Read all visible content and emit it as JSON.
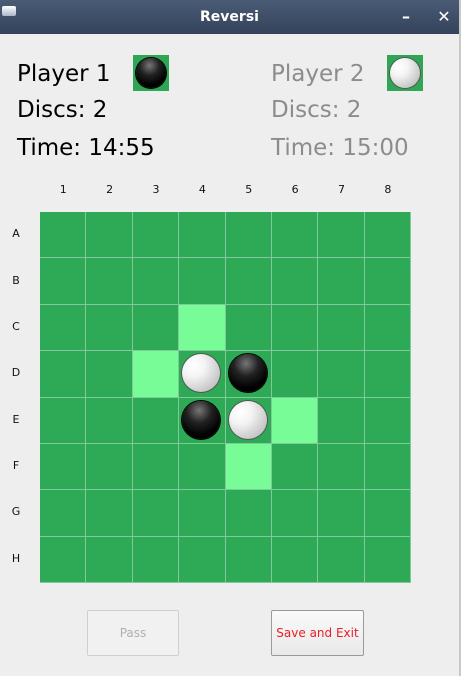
{
  "window": {
    "title": "Reversi"
  },
  "player1": {
    "name": "Player 1",
    "discs": "Discs: 2",
    "time": "Time: 14:55",
    "color": "#000000",
    "disc": "black"
  },
  "player2": {
    "name": "Player 2",
    "discs": "Discs: 2",
    "time": "Time: 15:00",
    "color": "#8c8c8c",
    "disc": "white"
  },
  "board": {
    "columns": [
      "1",
      "2",
      "3",
      "4",
      "5",
      "6",
      "7",
      "8"
    ],
    "rows": [
      "A",
      "B",
      "C",
      "D",
      "E",
      "F",
      "G",
      "H"
    ],
    "cell_color": "#2eaa56",
    "valid_move_color": "#78fc98",
    "pieces": [
      {
        "row": "D",
        "col": 4,
        "disc": "white"
      },
      {
        "row": "D",
        "col": 5,
        "disc": "black"
      },
      {
        "row": "E",
        "col": 4,
        "disc": "black"
      },
      {
        "row": "E",
        "col": 5,
        "disc": "white"
      }
    ],
    "valid_moves": [
      {
        "row": "C",
        "col": 4
      },
      {
        "row": "D",
        "col": 3
      },
      {
        "row": "E",
        "col": 6
      },
      {
        "row": "F",
        "col": 5
      }
    ]
  },
  "buttons": {
    "pass": "Pass",
    "save_exit": "Save and Exit"
  }
}
